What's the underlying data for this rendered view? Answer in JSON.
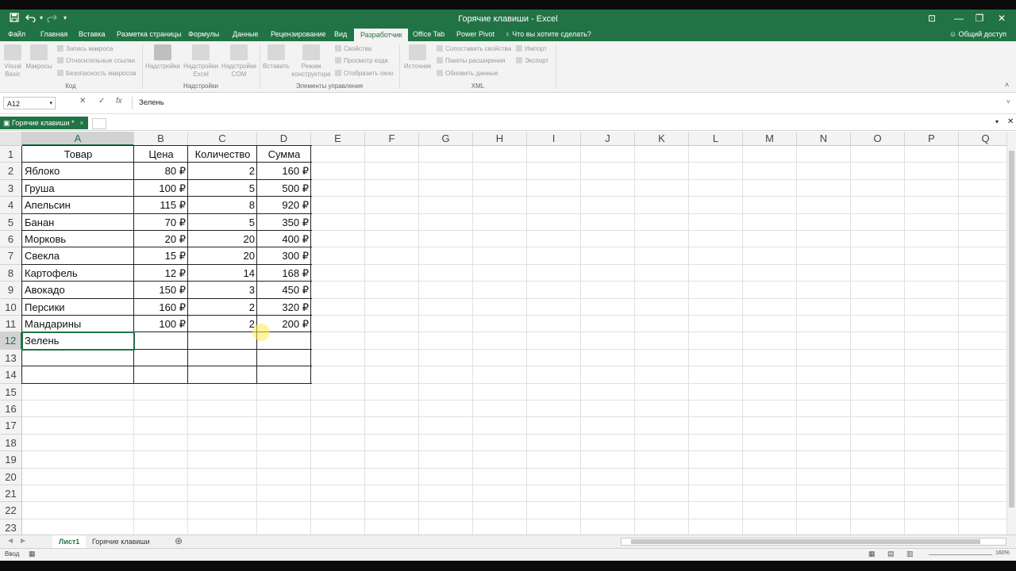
{
  "window": {
    "title": "Горячие клавиши - Excel"
  },
  "quick_access": {
    "save_icon": "save-icon",
    "undo_icon": "undo-icon",
    "redo_icon": "redo-icon",
    "customize_icon": "customize-icon"
  },
  "window_controls": {
    "minimize": "—",
    "restore": "❐",
    "close": "✕",
    "ribbon_display": "⊡"
  },
  "ribbon_tabs": [
    "Файл",
    "Главная",
    "Вставка",
    "Разметка страницы",
    "Формулы",
    "Данные",
    "Рецензирование",
    "Вид",
    "Разработчик",
    "Office Tab",
    "Power Pivot",
    "Что вы хотите сделать?"
  ],
  "active_tab": "Разработчик",
  "share": "Общий доступ",
  "ribbon": {
    "code": {
      "visual_basic": "Visual Basic",
      "macros": "Макросы",
      "record_macro": "Запись макроса",
      "relative_refs": "Относительные ссылки",
      "macro_security": "Безопасность макросов",
      "group": "Код"
    },
    "addins": {
      "addins": "Надстройки",
      "excel_addins": "Надстройки Excel",
      "com_addins": "Надстройки COM",
      "group": "Надстройки"
    },
    "controls": {
      "insert": "Вставить",
      "design_mode": "Режим конструктора",
      "properties": "Свойства",
      "view_code": "Просмотр кода",
      "show_window": "Отобразить окно",
      "group": "Элементы управления"
    },
    "xml": {
      "source": "Источник",
      "map_properties": "Сопоставить свойства",
      "expansion_packs": "Пакеты расширения",
      "refresh_data": "Обновить данные",
      "import": "Импорт",
      "export": "Экспорт",
      "group": "XML"
    }
  },
  "formula_bar": {
    "name_box": "A12",
    "formula": "Зелень",
    "cancel": "✕",
    "enter": "✓",
    "fx": "fx"
  },
  "workbook_tab": {
    "label": "Горячие клавиши *"
  },
  "columns": [
    "A",
    "B",
    "C",
    "D",
    "E",
    "F",
    "G",
    "H",
    "I",
    "J",
    "K",
    "L",
    "M",
    "N",
    "O",
    "P",
    "Q"
  ],
  "rows": [
    "1",
    "2",
    "3",
    "4",
    "5",
    "6",
    "7",
    "8",
    "9",
    "10",
    "11",
    "12",
    "13",
    "14",
    "15",
    "16",
    "17",
    "18",
    "19",
    "20",
    "21",
    "22",
    "23"
  ],
  "table": {
    "headers": [
      "Товар",
      "Цена",
      "Количество",
      "Сумма"
    ],
    "rows": [
      [
        "Яблоко",
        "80 ₽",
        "2",
        "160 ₽"
      ],
      [
        "Груша",
        "100 ₽",
        "5",
        "500 ₽"
      ],
      [
        "Апельсин",
        "115 ₽",
        "8",
        "920 ₽"
      ],
      [
        "Банан",
        "70 ₽",
        "5",
        "350 ₽"
      ],
      [
        "Морковь",
        "20 ₽",
        "20",
        "400 ₽"
      ],
      [
        "Свекла",
        "15 ₽",
        "20",
        "300 ₽"
      ],
      [
        "Картофель",
        "12 ₽",
        "14",
        "168 ₽"
      ],
      [
        "Авокадо",
        "150 ₽",
        "3",
        "450 ₽"
      ],
      [
        "Персики",
        "160 ₽",
        "2",
        "320 ₽"
      ],
      [
        "Мандарины",
        "100 ₽",
        "2",
        "200 ₽"
      ],
      [
        "Зелень",
        "",
        "",
        ""
      ],
      [
        "",
        "",
        "",
        ""
      ],
      [
        "",
        "",
        "",
        ""
      ]
    ]
  },
  "selected_cell": "A12",
  "sheets": [
    "Лист1",
    "Горячие клавиши"
  ],
  "active_sheet": "Лист1",
  "status": "Ввод",
  "zoom": "160%",
  "colors": {
    "excel_green": "#217346"
  }
}
